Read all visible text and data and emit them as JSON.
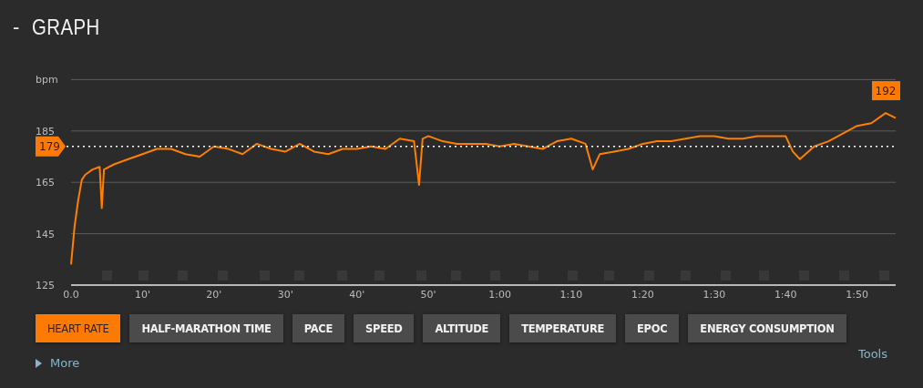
{
  "header": {
    "toggle": "-",
    "title": "GRAPH"
  },
  "chart_data": {
    "type": "line",
    "ylabel": "bpm",
    "xlim": [
      0,
      115.4
    ],
    "ylim": [
      125,
      205
    ],
    "yticks": [
      125,
      145,
      165,
      185
    ],
    "xticks": [
      {
        "value": 0,
        "label": "0.0"
      },
      {
        "value": 10,
        "label": "10'"
      },
      {
        "value": 20,
        "label": "20'"
      },
      {
        "value": 30,
        "label": "30'"
      },
      {
        "value": 40,
        "label": "40'"
      },
      {
        "value": 50,
        "label": "50'"
      },
      {
        "value": 60,
        "label": "1:00"
      },
      {
        "value": 70,
        "label": "1:10"
      },
      {
        "value": 80,
        "label": "1:20"
      },
      {
        "value": 90,
        "label": "1:30"
      },
      {
        "value": 100,
        "label": "1:40"
      },
      {
        "value": 110,
        "label": "1:50"
      }
    ],
    "x": [
      0,
      0.5,
      1,
      1.5,
      2,
      3,
      4,
      4.3,
      4.6,
      6,
      8,
      10,
      12,
      14,
      16,
      18,
      20,
      22,
      24,
      26,
      28,
      30,
      32,
      34,
      36,
      38,
      40,
      42,
      44,
      46,
      48,
      48.7,
      49.2,
      50,
      52,
      54,
      56,
      58,
      60,
      62,
      64,
      66,
      68,
      70,
      72,
      73,
      74,
      76,
      78,
      80,
      82,
      84,
      86,
      88,
      90,
      92,
      94,
      96,
      98,
      100,
      101,
      102,
      104,
      106,
      108,
      110,
      112,
      114,
      115.4
    ],
    "series": [
      {
        "color": "#ff7f00",
        "values": [
          133,
          148,
          158,
          166,
          168,
          170,
          171,
          155,
          170,
          172,
          174,
          176,
          178,
          178,
          176,
          175,
          179,
          178,
          176,
          180,
          178,
          177,
          180,
          177,
          176,
          178,
          178,
          179,
          178,
          182,
          181,
          164,
          182,
          183,
          181,
          180,
          180,
          180,
          179,
          180,
          179,
          178,
          181,
          182,
          180,
          170,
          176,
          177,
          178,
          180,
          181,
          181,
          182,
          183,
          183,
          182,
          182,
          183,
          183,
          183,
          177,
          174,
          179,
          181,
          184,
          187,
          188,
          192,
          190
        ]
      }
    ],
    "grid": true,
    "ref_lines": [
      {
        "axis": "y",
        "value": 179,
        "label": "179"
      }
    ],
    "annotations": [
      {
        "x": 114,
        "y": 192,
        "text": "192"
      }
    ]
  },
  "buttons": [
    {
      "label": "HEART RATE",
      "selected": true
    },
    {
      "label": "HALF-MARATHON TIME",
      "selected": false
    },
    {
      "label": "PACE",
      "selected": false
    },
    {
      "label": "SPEED",
      "selected": false
    },
    {
      "label": "ALTITUDE",
      "selected": false
    },
    {
      "label": "TEMPERATURE",
      "selected": false
    },
    {
      "label": "EPOC",
      "selected": false
    },
    {
      "label": "ENERGY CONSUMPTION",
      "selected": false
    }
  ],
  "more": "More",
  "tools": "Tools"
}
